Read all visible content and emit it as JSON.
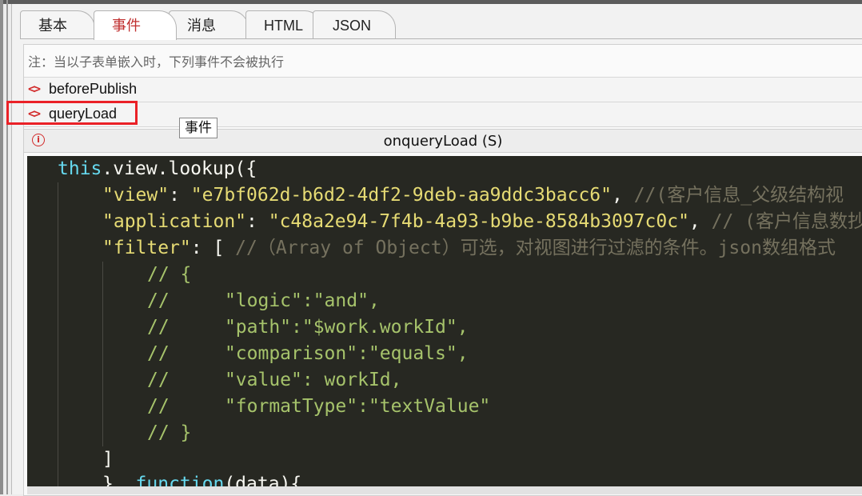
{
  "tabs": [
    {
      "label": "基本",
      "active": false
    },
    {
      "label": "事件",
      "active": true
    },
    {
      "label": "消息",
      "active": false
    },
    {
      "label": "HTML",
      "active": false
    },
    {
      "label": "JSON",
      "active": false
    }
  ],
  "note": "注：当以子表单嵌入时，下列事件不会被执行",
  "events": [
    {
      "icon": "code-icon",
      "label": "beforePublish"
    },
    {
      "icon": "code-icon",
      "label": "queryLoad",
      "highlighted": true
    }
  ],
  "tooltip": "事件",
  "editor": {
    "title": "onqueryLoad (S)",
    "lines": {
      "l1a": "this",
      "l1b": ".view.lookup({",
      "l2a": "\"view\"",
      "l2b": ": ",
      "l2c": "\"e7bf062d-b6d2-4df2-9deb-aa9ddc3bacc6\"",
      "l2d": ", ",
      "l2e": "//(客户信息_父级结构视",
      "l3a": "\"application\"",
      "l3b": ": ",
      "l3c": "\"c48a2e94-7f4b-4a93-b9be-8584b3097c0c\"",
      "l3d": ", ",
      "l3e": "// (客户信息数抄",
      "l4a": "\"filter\"",
      "l4b": ": [ ",
      "l4c": "//（Array of Object）可选，对视图进行过滤的条件。json数组格式",
      "l5": "// {",
      "l6a": "//     ",
      "l6b": "\"logic\":\"and\",",
      "l7a": "//     ",
      "l7b": "\"path\":\"$work.workId\",",
      "l8a": "//     ",
      "l8b": "\"comparison\":\"equals\",",
      "l9a": "//     ",
      "l9b": "\"value\": workId,",
      "l10a": "//     ",
      "l10b": "\"formatType\":\"textValue\"",
      "l11": "// }",
      "l12": "]",
      "l13a": "}, ",
      "l13b": "function",
      "l13c": "(data){"
    }
  },
  "colors": {
    "accent_red": "#d22b2b",
    "highlight_box": "#ea2127",
    "editor_bg": "#272822",
    "keyword": "#66d9ef",
    "string": "#e6db74",
    "comment": "#75715e",
    "comment_green": "#a6c36b"
  }
}
